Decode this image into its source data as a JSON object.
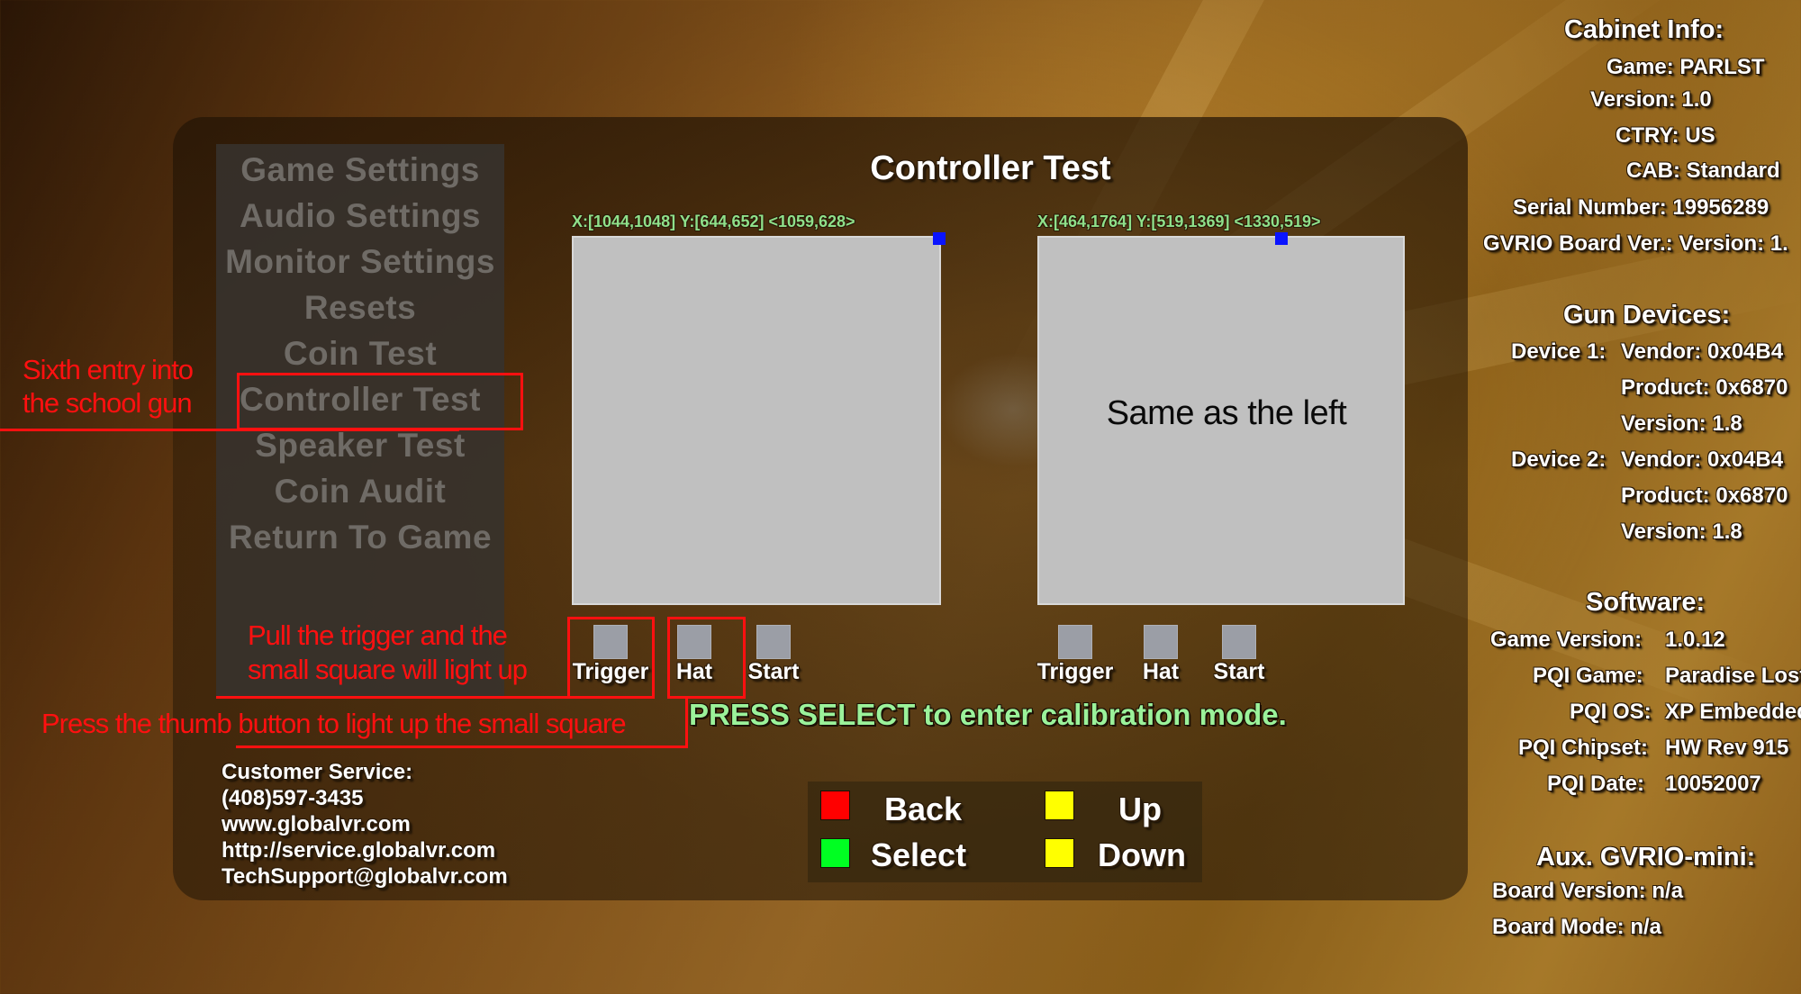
{
  "title": "Controller Test",
  "menu": {
    "items": [
      {
        "label": "Game Settings"
      },
      {
        "label": "Audio Settings"
      },
      {
        "label": "Monitor Settings"
      },
      {
        "label": "Resets"
      },
      {
        "label": "Coin Test"
      },
      {
        "label": "Controller Test"
      },
      {
        "label": "Speaker Test"
      },
      {
        "label": "Coin Audit"
      },
      {
        "label": "Return To Game"
      }
    ],
    "selected_index": 5
  },
  "players": [
    {
      "coord_readout": "X:[1044,1048] Y:[644,652]  <1059,628>",
      "buttons": [
        {
          "label": "Trigger",
          "lit": false
        },
        {
          "label": "Hat",
          "lit": false
        },
        {
          "label": "Start",
          "lit": false
        }
      ]
    },
    {
      "coord_readout": "X:[464,1764] Y:[519,1369]  <1330,519>",
      "buttons": [
        {
          "label": "Trigger",
          "lit": false
        },
        {
          "label": "Hat",
          "lit": false
        },
        {
          "label": "Start",
          "lit": false
        }
      ]
    }
  ],
  "calibration_prompt": "PRESS SELECT to enter calibration mode.",
  "legend": [
    {
      "label": "Back",
      "color": "#ff0000"
    },
    {
      "label": "Select",
      "color": "#00ff22"
    },
    {
      "label": "Up",
      "color": "#ffff00"
    },
    {
      "label": "Down",
      "color": "#ffff00"
    }
  ],
  "customer_service": {
    "heading": "Customer Service:",
    "phone": "(408)597-3435",
    "website": "www.globalvr.com",
    "service_url": "http://service.globalvr.com",
    "email": "TechSupport@globalvr.com"
  },
  "cabinet_info": {
    "heading": "Cabinet Info:",
    "game": "Game: PARLST",
    "version": "Version: 1.0",
    "ctry": "CTRY: US",
    "cab": "CAB: Standard",
    "serial": "Serial Number: 19956289",
    "gvrio": "GVRIO Board Ver.: Version: 1."
  },
  "gun_devices": {
    "heading": "Gun Devices:",
    "device1_label": "Device 1:",
    "device1_vendor": "Vendor: 0x04B4",
    "device1_product": "Product: 0x6870",
    "device1_version": "Version: 1.8",
    "device2_label": "Device 2:",
    "device2_vendor": "Vendor: 0x04B4",
    "device2_product": "Product: 0x6870",
    "device2_version": "Version: 1.8"
  },
  "software": {
    "heading": "Software:",
    "rows": [
      {
        "key": "Game Version:",
        "value": "1.0.12"
      },
      {
        "key": "PQI Game:",
        "value": "Paradise Lost"
      },
      {
        "key": "PQI OS:",
        "value": "XP Embedded"
      },
      {
        "key": "PQI Chipset:",
        "value": "HW Rev 915"
      },
      {
        "key": "PQI Date:",
        "value": "10052007"
      }
    ]
  },
  "aux": {
    "heading": "Aux. GVRIO-mini:",
    "board_version": "Board Version:  n/a",
    "board_mode": "Board Mode:  n/a"
  },
  "annotations": {
    "menu_note_line1": "Sixth entry into",
    "menu_note_line2": "the school gun",
    "trigger_note_line1": "Pull the trigger and the",
    "trigger_note_line2": "small square will light up",
    "hat_note": "Press the thumb button to light up the small square",
    "right_screen_note": "Same as the left",
    "color": "#ff1010"
  }
}
